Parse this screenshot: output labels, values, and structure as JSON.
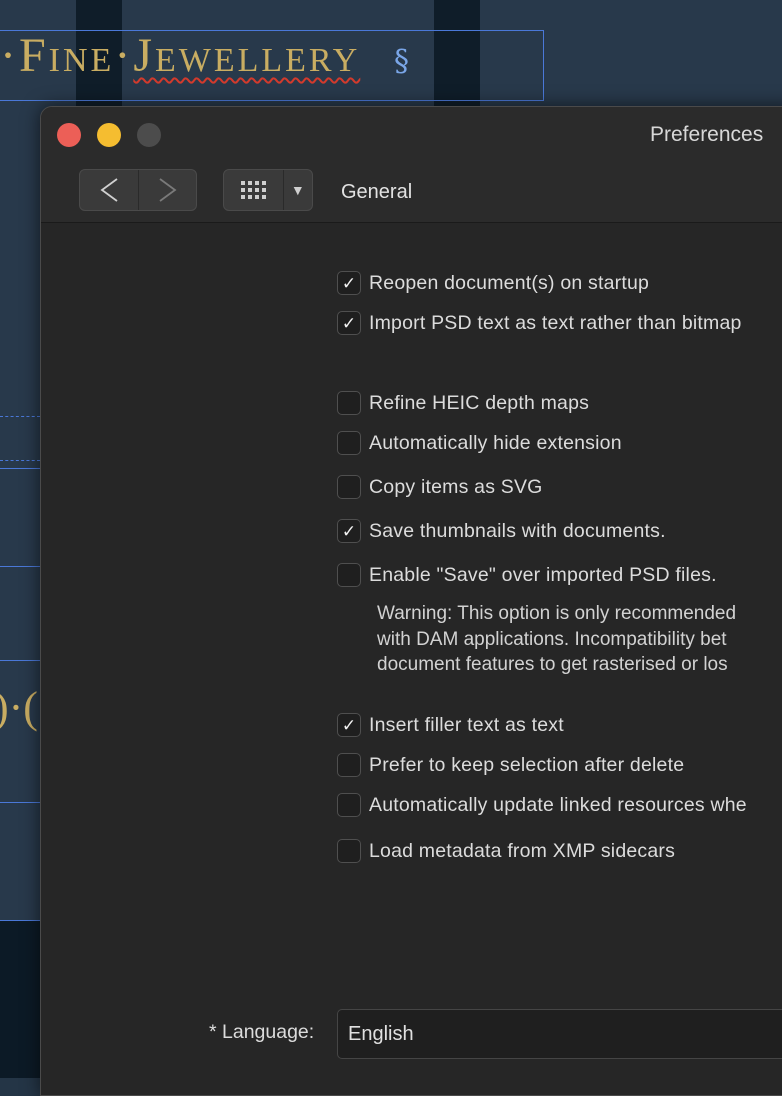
{
  "background": {
    "heading_prefix": "·",
    "heading_word1": "Fine",
    "heading_sep": "·",
    "heading_word2": "Jewellery",
    "paragraph_mark": "§",
    "fragment": ")·("
  },
  "window": {
    "title": "Preferences",
    "section": "General",
    "back_glyph": "<",
    "forward_glyph": ">",
    "dropdown_glyph": "▼"
  },
  "options": [
    {
      "label": "Reopen document(s) on startup",
      "checked": true
    },
    {
      "label": "Import PSD text as text rather than bitmap",
      "checked": true
    },
    {
      "label": "Refine HEIC depth maps",
      "checked": false
    },
    {
      "label": "Automatically hide extension",
      "checked": false
    },
    {
      "label": "Copy items as SVG",
      "checked": false
    },
    {
      "label": "Save thumbnails with documents.",
      "checked": true
    },
    {
      "label": "Enable \"Save\" over imported PSD files.",
      "checked": false
    },
    {
      "label": "Insert filler text as text",
      "checked": true
    },
    {
      "label": "Prefer to keep selection after delete",
      "checked": false
    },
    {
      "label": "Automatically update linked resources whe",
      "checked": false
    },
    {
      "label": "Load metadata from XMP sidecars",
      "checked": false
    }
  ],
  "warning_lines": [
    "Warning: This option is only recommended",
    "with DAM applications. Incompatibility bet",
    "document features to get rasterised or los"
  ],
  "language": {
    "label": "* Language:",
    "value": "English"
  },
  "colors": {
    "close": "#ec5f57",
    "minimize": "#f5bd30",
    "zoom_disabled": "#4c4c4c",
    "heading_gold": "#c9ad62",
    "selection_blue": "#4a78d8",
    "spell_red": "#d33a2c"
  }
}
